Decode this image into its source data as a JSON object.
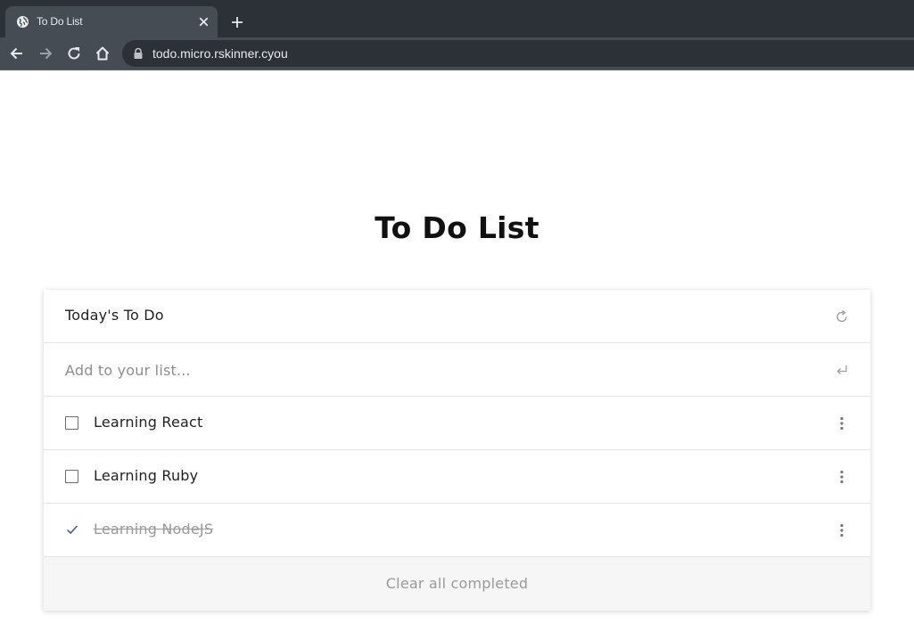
{
  "browser": {
    "tab_title": "To Do List",
    "url": "todo.micro.rskinner.cyou",
    "colors": {
      "frame": "#2b3136",
      "toolbar": "#454c53",
      "text": "#e8eaed"
    }
  },
  "icons": {
    "favicon": "globe-icon",
    "tab_close": "close-icon",
    "new_tab": "plus-icon",
    "back": "arrow-left-icon",
    "forward": "arrow-right-icon",
    "reload": "reload-icon",
    "home": "home-icon",
    "lock": "lock-icon",
    "refresh": "refresh-icon",
    "enter": "enter-icon",
    "more": "more-vertical-icon",
    "check": "checkmark-icon"
  },
  "page": {
    "title": "To Do List"
  },
  "list": {
    "header_title": "Today's To Do",
    "add_placeholder": "Add to your list...",
    "add_value": "",
    "items": [
      {
        "label": "Learning React",
        "completed": false
      },
      {
        "label": "Learning Ruby",
        "completed": false
      },
      {
        "label": "Learning NodeJS",
        "completed": true
      }
    ],
    "clear_label": "Clear all completed",
    "accent_color": "#3f51b5"
  }
}
